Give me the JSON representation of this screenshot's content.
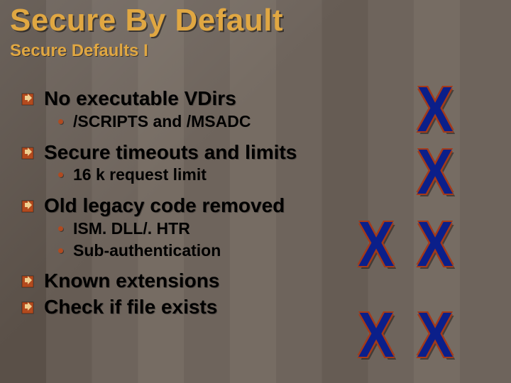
{
  "title": "Secure By Default",
  "subtitle": "Secure Defaults I",
  "items": [
    {
      "text": "No executable VDirs",
      "sub": [
        "/SCRIPTS and /MSADC"
      ]
    },
    {
      "text": "Secure timeouts and limits",
      "sub": [
        "16 k request limit"
      ]
    },
    {
      "text": "Old legacy code removed",
      "sub": [
        "ISM. DLL/. HTR",
        "Sub-authentication"
      ]
    },
    {
      "text": "Known extensions",
      "sub": []
    },
    {
      "text": "Check if file exists",
      "sub": []
    }
  ],
  "x_glyph": "X",
  "colors": {
    "accent": "#e0a742",
    "x_fill": "#0b1f8a",
    "x_outline": "#a43a1a",
    "sub_bullet": "#b04a20"
  }
}
